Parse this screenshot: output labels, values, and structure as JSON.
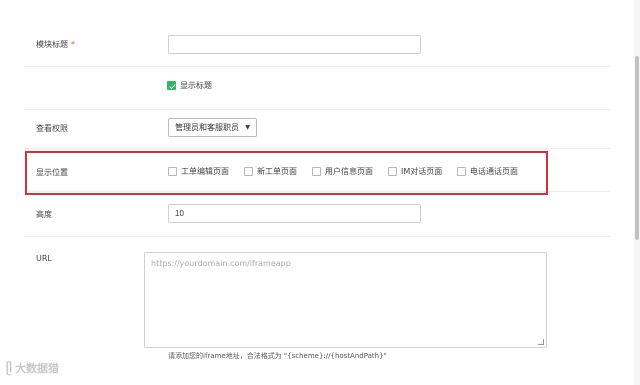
{
  "form": {
    "module_title": {
      "label": "模块标题",
      "required_mark": "*",
      "value": ""
    },
    "show_title": {
      "label": "显示标题",
      "checked": true
    },
    "view_permission": {
      "label": "查看权限",
      "selected": "管理员和客服职员"
    },
    "display_position": {
      "label": "显示位置",
      "options": [
        {
          "label": "工单编辑页面",
          "checked": false
        },
        {
          "label": "新工单页面",
          "checked": false
        },
        {
          "label": "用户信息页面",
          "checked": false
        },
        {
          "label": "IM对话页面",
          "checked": false
        },
        {
          "label": "电话通话页面",
          "checked": false
        }
      ]
    },
    "height": {
      "label": "高度",
      "value": "10"
    },
    "url": {
      "label": "URL",
      "placeholder": "https://yourdomain.com/iframeapp",
      "hint": "请添加您的iframe地址，合法格式为 \"{scheme}://{hostAndPath}\""
    }
  },
  "watermark": {
    "text": "大数据猎"
  },
  "colors": {
    "highlight_border": "#d6303a",
    "checkbox_checked": "#31b46b"
  }
}
